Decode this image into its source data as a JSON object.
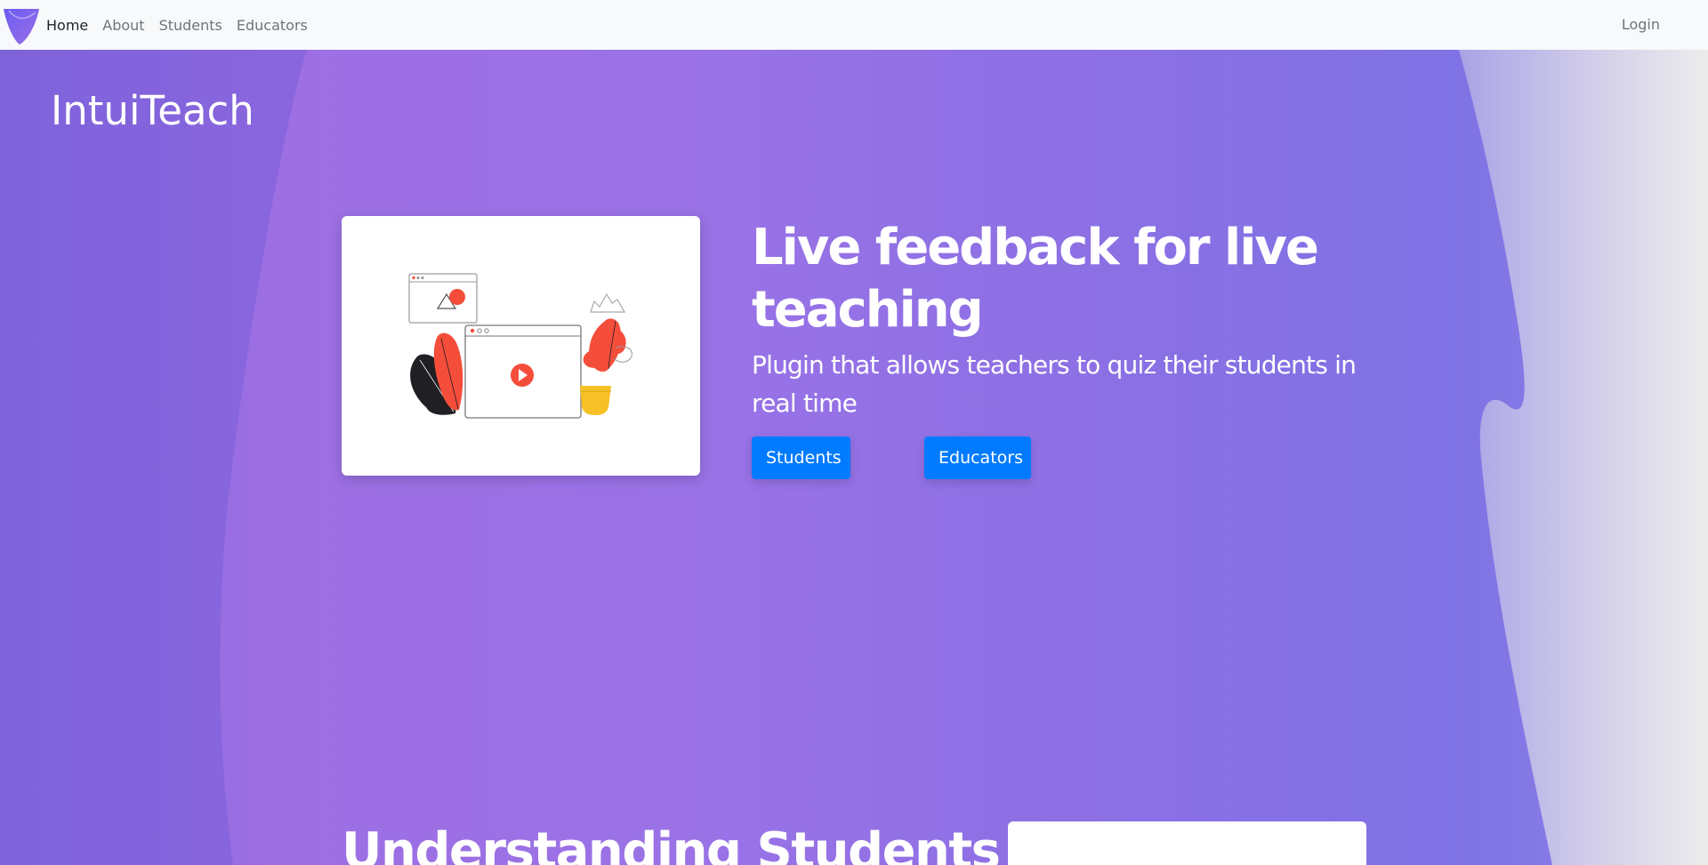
{
  "navbar": {
    "links": [
      {
        "label": "Home",
        "active": true
      },
      {
        "label": "About",
        "active": false
      },
      {
        "label": "Students",
        "active": false
      },
      {
        "label": "Educators",
        "active": false
      }
    ],
    "login_label": "Login"
  },
  "hero": {
    "site_title": "IntuiTeach",
    "heading": "Live feedback for live teaching",
    "subheading": "Plugin that allows teachers to quiz their students in real time",
    "buttons": {
      "students_label": "Students",
      "educators_label": "Educators"
    }
  },
  "section": {
    "heading": "Understanding Students"
  },
  "colors": {
    "primary_button": "#007bff",
    "navbar_bg": "#f8f9fa",
    "hero_purple": "#9a72e6",
    "illustration_red": "#f44d3a",
    "illustration_yellow": "#f6c026"
  },
  "icons": {
    "brand": "brand-logo-icon",
    "play": "play-icon"
  }
}
